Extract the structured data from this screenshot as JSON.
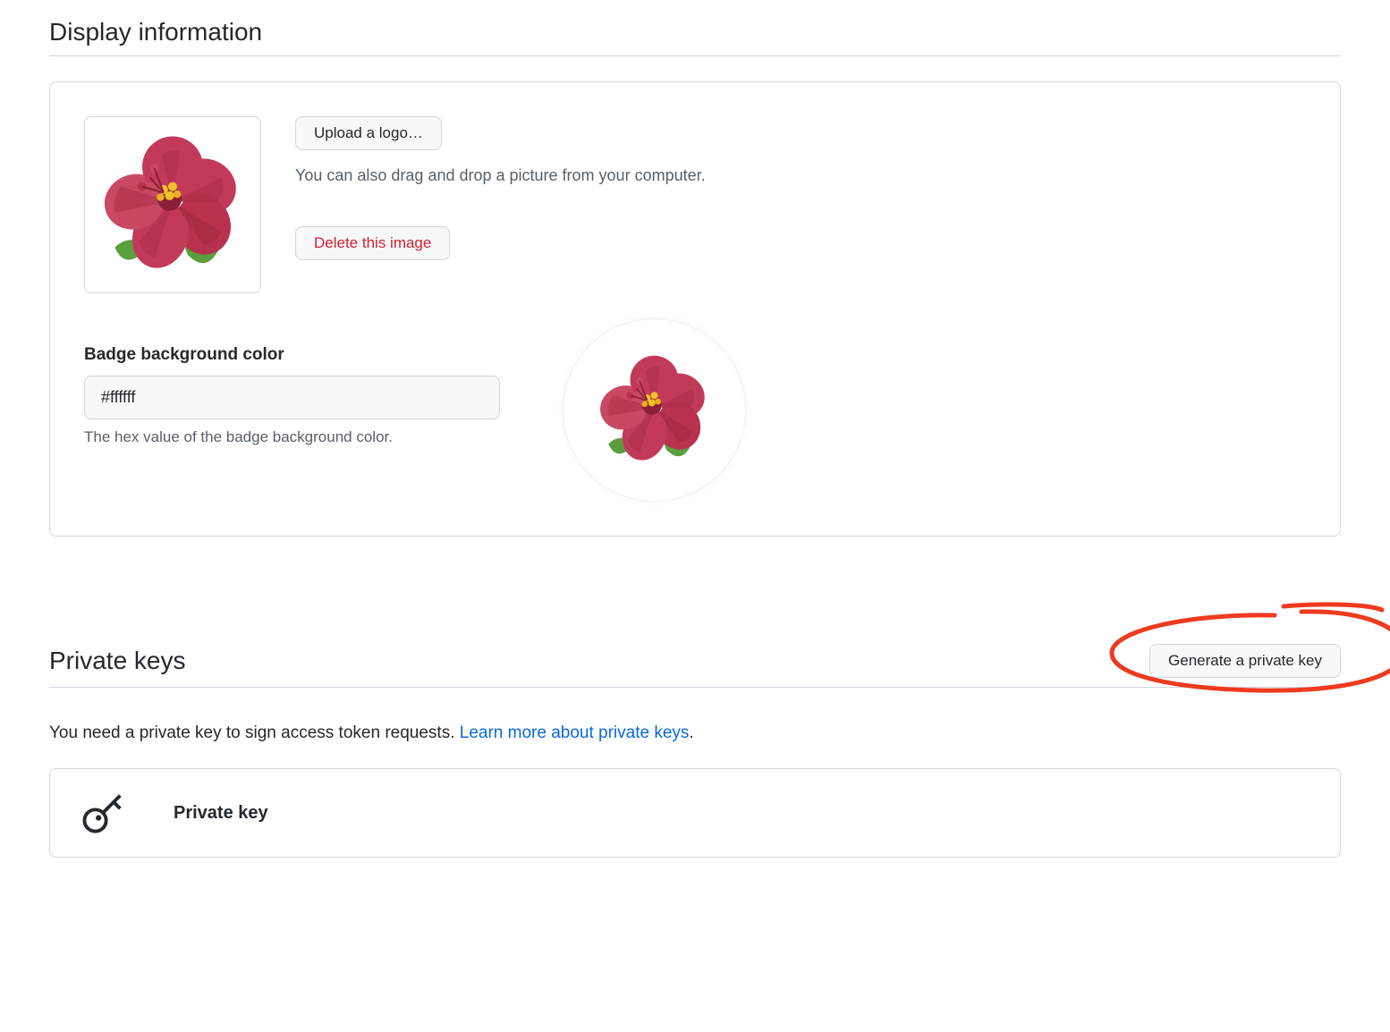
{
  "display_info": {
    "heading": "Display information",
    "upload_button": "Upload a logo…",
    "drag_hint": "You can also drag and drop a picture from your computer.",
    "delete_button": "Delete this image",
    "badge_label": "Badge background color",
    "badge_value": "#ffffff",
    "badge_hint": "The hex value of the badge background color."
  },
  "private_keys": {
    "heading": "Private keys",
    "generate_button": "Generate a private key",
    "description_prefix": "You need a private key to sign access token requests. ",
    "learn_more": "Learn more about private keys",
    "description_suffix": ".",
    "item_label": "Private key"
  }
}
